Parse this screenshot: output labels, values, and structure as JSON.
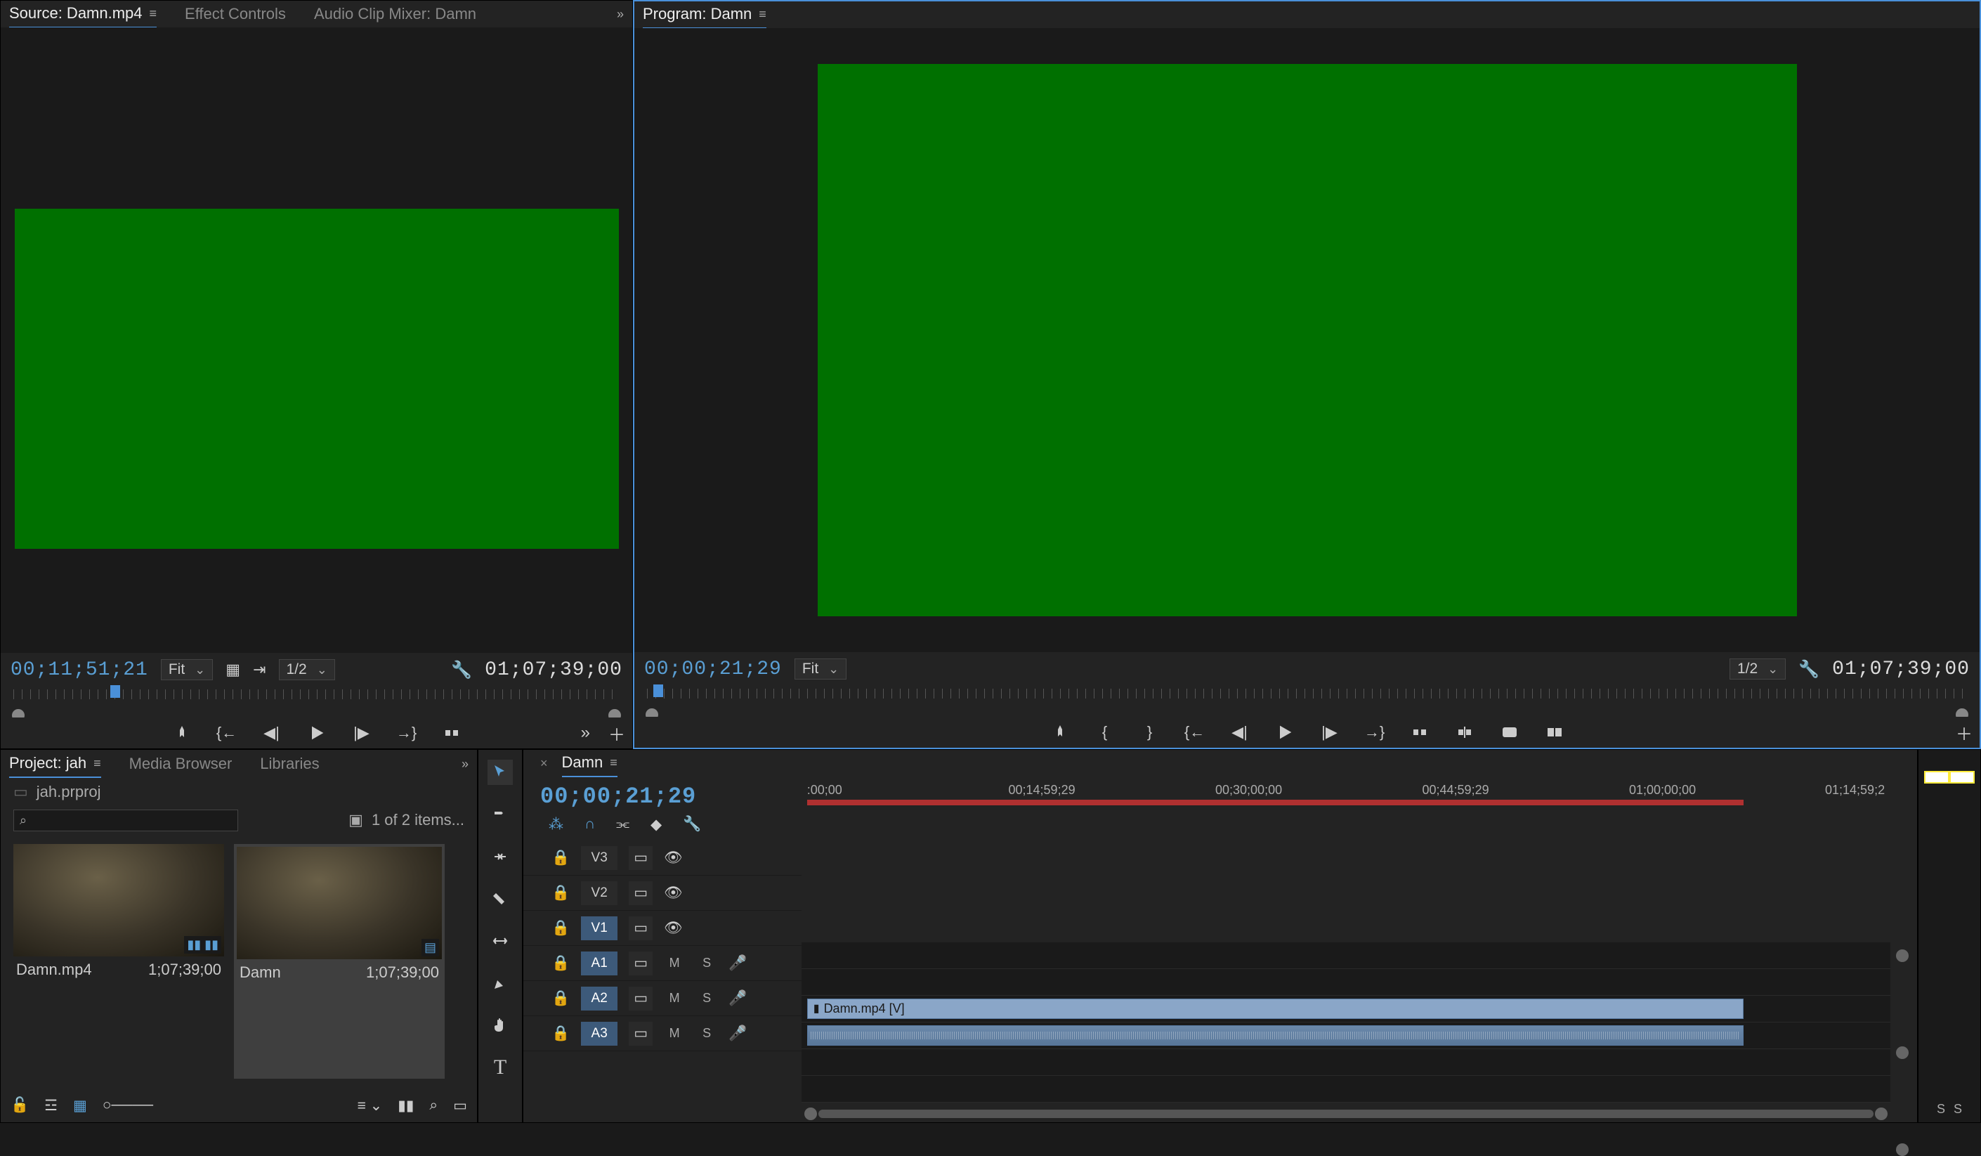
{
  "source_panel": {
    "tabs": [
      "Source: Damn.mp4",
      "Effect Controls",
      "Audio Clip Mixer: Damn"
    ],
    "active_tab": 0,
    "timecode_current": "00;11;51;21",
    "timecode_duration": "01;07;39;00",
    "fit_label": "Fit",
    "res_label": "1/2"
  },
  "program_panel": {
    "title": "Program: Damn",
    "timecode_current": "00;00;21;29",
    "timecode_duration": "01;07;39;00",
    "fit_label": "Fit",
    "res_label": "1/2"
  },
  "project_panel": {
    "tabs": [
      "Project: jah",
      "Media Browser",
      "Libraries"
    ],
    "active_tab": 0,
    "project_file": "jah.prproj",
    "item_count": "1 of 2 items...",
    "search_placeholder": "",
    "items": [
      {
        "name": "Damn.mp4",
        "duration": "1;07;39;00",
        "selected": false
      },
      {
        "name": "Damn",
        "duration": "1;07;39;00",
        "selected": true
      }
    ]
  },
  "timeline": {
    "sequence_name": "Damn",
    "timecode": "00;00;21;29",
    "ruler_ticks": [
      ":00;00",
      "00;14;59;29",
      "00;30;00;00",
      "00;44;59;29",
      "01;00;00;00",
      "01;14;59;2"
    ],
    "video_tracks": [
      {
        "id": "V3",
        "targeted": false
      },
      {
        "id": "V2",
        "targeted": false
      },
      {
        "id": "V1",
        "targeted": true
      }
    ],
    "audio_tracks": [
      {
        "id": "A1",
        "targeted": true
      },
      {
        "id": "A2",
        "targeted": true
      },
      {
        "id": "A3",
        "targeted": true
      }
    ],
    "clip_name": "Damn.mp4 [V]",
    "ms_label_m": "M",
    "ms_label_s": "S"
  },
  "meter_labels": [
    "S",
    "S"
  ]
}
